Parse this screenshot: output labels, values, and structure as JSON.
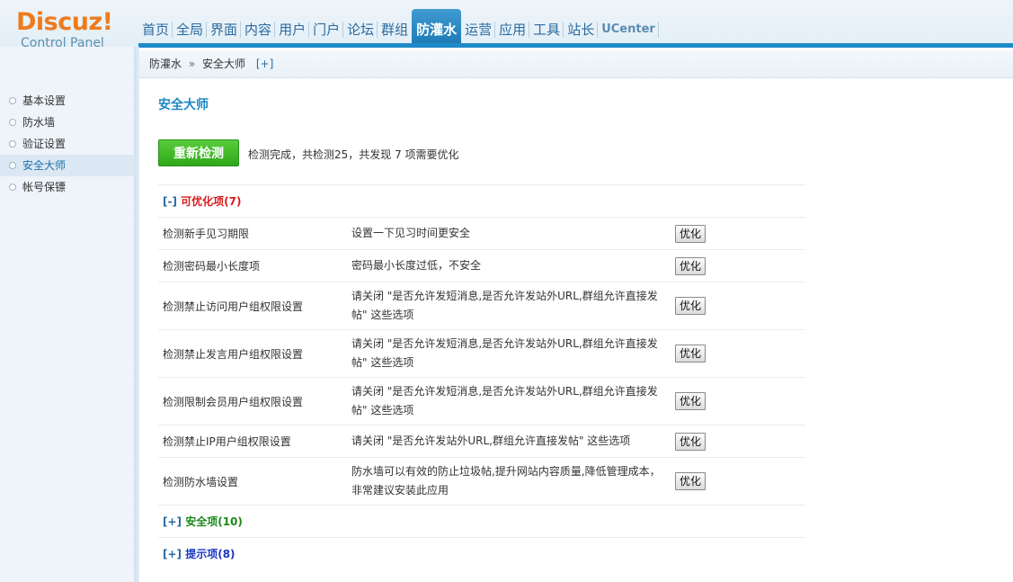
{
  "logo": {
    "word": "Discuz!",
    "sub": "Control Panel"
  },
  "topnav": [
    {
      "label": "首页",
      "active": false
    },
    {
      "label": "全局",
      "active": false
    },
    {
      "label": "界面",
      "active": false
    },
    {
      "label": "内容",
      "active": false
    },
    {
      "label": "用户",
      "active": false
    },
    {
      "label": "门户",
      "active": false
    },
    {
      "label": "论坛",
      "active": false
    },
    {
      "label": "群组",
      "active": false
    },
    {
      "label": "防灌水",
      "active": true
    },
    {
      "label": "运营",
      "active": false
    },
    {
      "label": "应用",
      "active": false
    },
    {
      "label": "工具",
      "active": false
    },
    {
      "label": "站长",
      "active": false
    },
    {
      "label": "UCenter",
      "active": false
    }
  ],
  "sidebar": {
    "items": [
      {
        "label": "基本设置",
        "active": false
      },
      {
        "label": "防水墙",
        "active": false
      },
      {
        "label": "验证设置",
        "active": false
      },
      {
        "label": "安全大师",
        "active": true
      },
      {
        "label": "帐号保镖",
        "active": false
      }
    ]
  },
  "breadcrumb": {
    "section": "防灌水",
    "separator": "»",
    "page": "安全大师",
    "add": "[+]"
  },
  "main": {
    "title": "安全大师",
    "recheck_button": "重新检测",
    "summary": "检测完成，共检测25，共发现 7 项需要优化",
    "groups": {
      "optimizable": {
        "toggle": "[-]",
        "label": "可优化项(7)"
      },
      "safe": {
        "toggle": "[+]",
        "label": "安全项(10)"
      },
      "tips": {
        "toggle": "[+]",
        "label": "提示项(8)"
      }
    },
    "optimize_label": "优化",
    "items": [
      {
        "name": "检测新手见习期限",
        "desc": "设置一下见习时间更安全"
      },
      {
        "name": "检测密码最小长度项",
        "desc": "密码最小长度过低，不安全"
      },
      {
        "name": "检测禁止访问用户组权限设置",
        "desc": "请关闭 \"是否允许发短消息,是否允许发站外URL,群组允许直接发帖\" 这些选项"
      },
      {
        "name": "检测禁止发言用户组权限设置",
        "desc": "请关闭 \"是否允许发短消息,是否允许发站外URL,群组允许直接发帖\" 这些选项"
      },
      {
        "name": "检测限制会员用户组权限设置",
        "desc": "请关闭 \"是否允许发短消息,是否允许发站外URL,群组允许直接发帖\" 这些选项"
      },
      {
        "name": "检测禁止IP用户组权限设置",
        "desc": "请关闭 \"是否允许发站外URL,群组允许直接发帖\" 这些选项"
      },
      {
        "name": "检测防水墙设置",
        "desc": "防水墙可以有效的防止垃圾帖,提升网站内容质量,降低管理成本，非常建议安装此应用"
      }
    ]
  }
}
